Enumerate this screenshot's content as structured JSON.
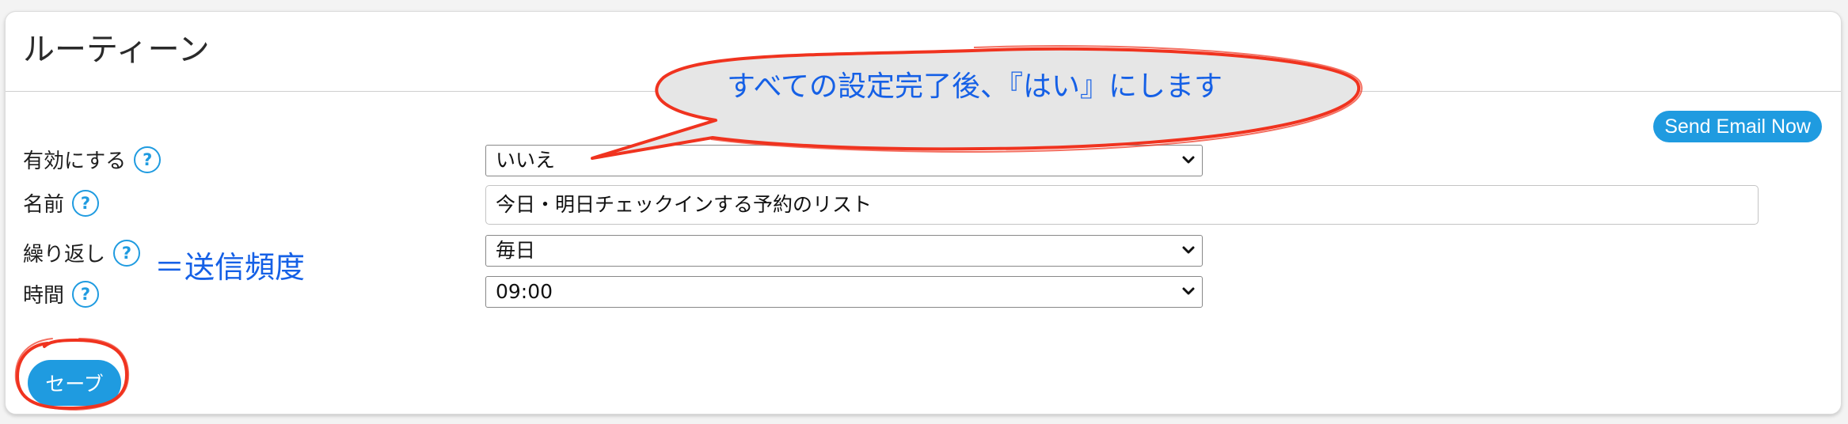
{
  "panel": {
    "title": "ルーティーン",
    "send_email_button": "Send Email Now",
    "help_glyph": "?"
  },
  "form": {
    "fields": [
      {
        "label": "有効にする",
        "value": "いいえ",
        "control": "select"
      },
      {
        "label": "名前",
        "value": "今日・明日チェックインする予約のリスト",
        "control": "text"
      },
      {
        "label": "繰り返し",
        "value": "毎日",
        "control": "select"
      },
      {
        "label": "時間",
        "value": "09:00",
        "control": "select"
      }
    ],
    "save_button": "セーブ"
  },
  "annotations": {
    "callout_text": "すべての設定完了後、『はい』にします",
    "frequency_note": "＝送信頻度",
    "text_color": "#1560e6",
    "stroke_color": "#f0331f"
  },
  "theme": {
    "accent": "#1f9be0"
  }
}
